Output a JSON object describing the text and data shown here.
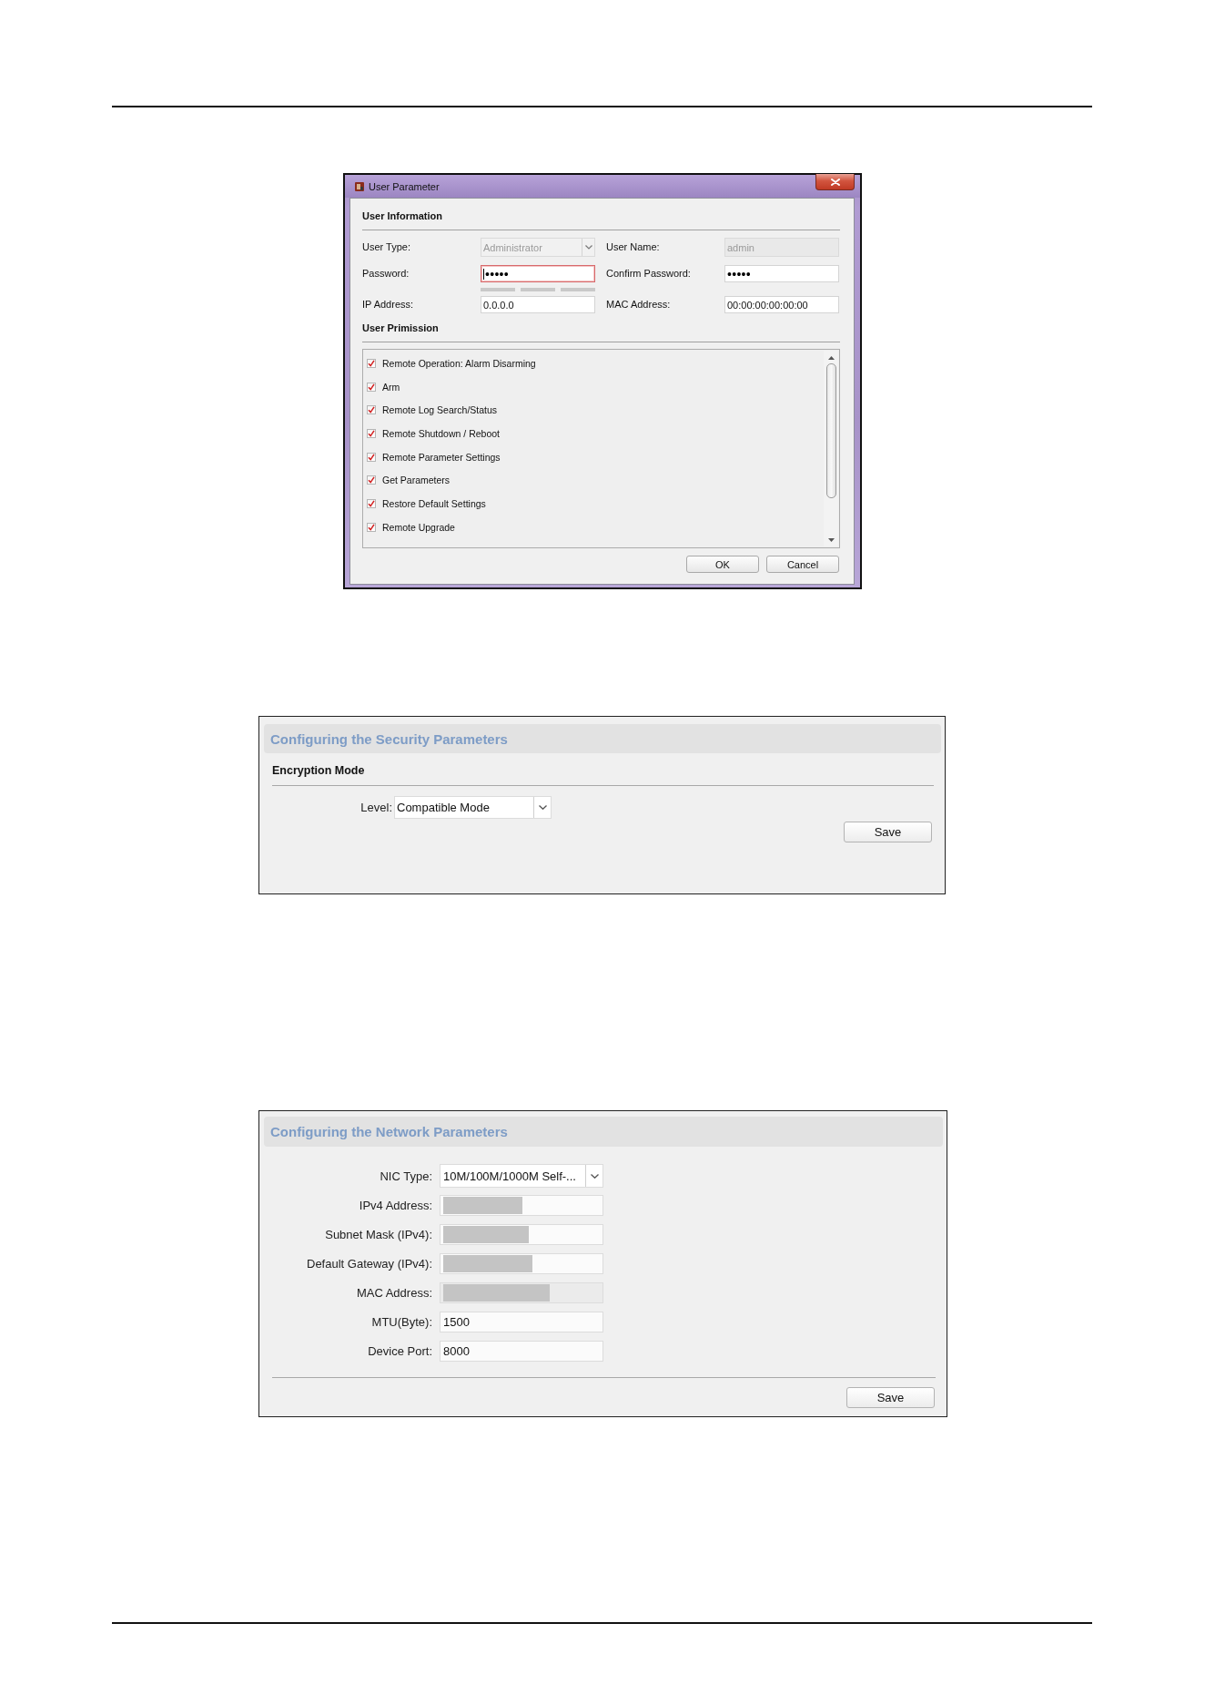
{
  "user_parameter_dialog": {
    "title": "User Parameter",
    "user_information": {
      "heading": "User Information",
      "fields": [
        {
          "label": "User Type:",
          "kind": "dropdown",
          "value": "Administrator",
          "disabled": true,
          "focused": false
        },
        {
          "label": "User Name:",
          "kind": "text",
          "value": "admin",
          "disabled": true,
          "focused": false
        },
        {
          "label": "Password:",
          "kind": "password",
          "value": "•••••",
          "disabled": false,
          "focused": true
        },
        {
          "label": "Confirm Password:",
          "kind": "password",
          "value": "•••••",
          "disabled": false,
          "focused": false
        },
        {
          "label": "IP Address:",
          "kind": "text",
          "value": "0.0.0.0",
          "disabled": false,
          "focused": false
        },
        {
          "label": "MAC Address:",
          "kind": "text",
          "value": "00:00:00:00:00:00",
          "disabled": false,
          "focused": false
        }
      ],
      "password_strength": {
        "segments": [
          {
            "lit": false
          },
          {
            "lit": false
          },
          {
            "lit": false
          }
        ]
      }
    },
    "user_permission": {
      "heading": "User Primission",
      "items": [
        {
          "label": "Remote Operation: Alarm Disarming",
          "checked": true
        },
        {
          "label": "Arm",
          "checked": true
        },
        {
          "label": "Remote Log Search/Status",
          "checked": true
        },
        {
          "label": "Remote Shutdown / Reboot",
          "checked": true
        },
        {
          "label": "Remote Parameter Settings",
          "checked": true
        },
        {
          "label": "Get Parameters",
          "checked": true
        },
        {
          "label": "Restore Default Settings",
          "checked": true
        },
        {
          "label": "Remote Upgrade",
          "checked": true
        }
      ]
    },
    "buttons": [
      {
        "label": "OK"
      },
      {
        "label": "Cancel"
      }
    ]
  },
  "security_parameters": {
    "title": "Configuring the Security Parameters",
    "section_heading": "Encryption Mode",
    "level_field": {
      "label": "Level:",
      "value": "Compatible Mode"
    },
    "save_button": {
      "label": "Save"
    }
  },
  "network_parameters": {
    "title": "Configuring the Network Parameters",
    "fields": [
      {
        "label": "NIC Type:",
        "kind": "dropdown",
        "value": "10M/100M/1000M Self-...",
        "redacted": false,
        "disabled": false
      },
      {
        "label": "IPv4 Address:",
        "kind": "text",
        "redacted": true,
        "disabled": false
      },
      {
        "label": "Subnet Mask (IPv4):",
        "kind": "text",
        "redacted": true,
        "disabled": false
      },
      {
        "label": "Default Gateway (IPv4):",
        "kind": "text",
        "redacted": true,
        "disabled": false
      },
      {
        "label": "MAC Address:",
        "kind": "text",
        "redacted": true,
        "disabled": true
      },
      {
        "label": "MTU(Byte):",
        "kind": "text",
        "value": "1500",
        "redacted": false,
        "disabled": false
      },
      {
        "label": "Device Port:",
        "kind": "text",
        "value": "8000",
        "redacted": false,
        "disabled": false
      }
    ],
    "save_button": {
      "label": "Save"
    }
  }
}
